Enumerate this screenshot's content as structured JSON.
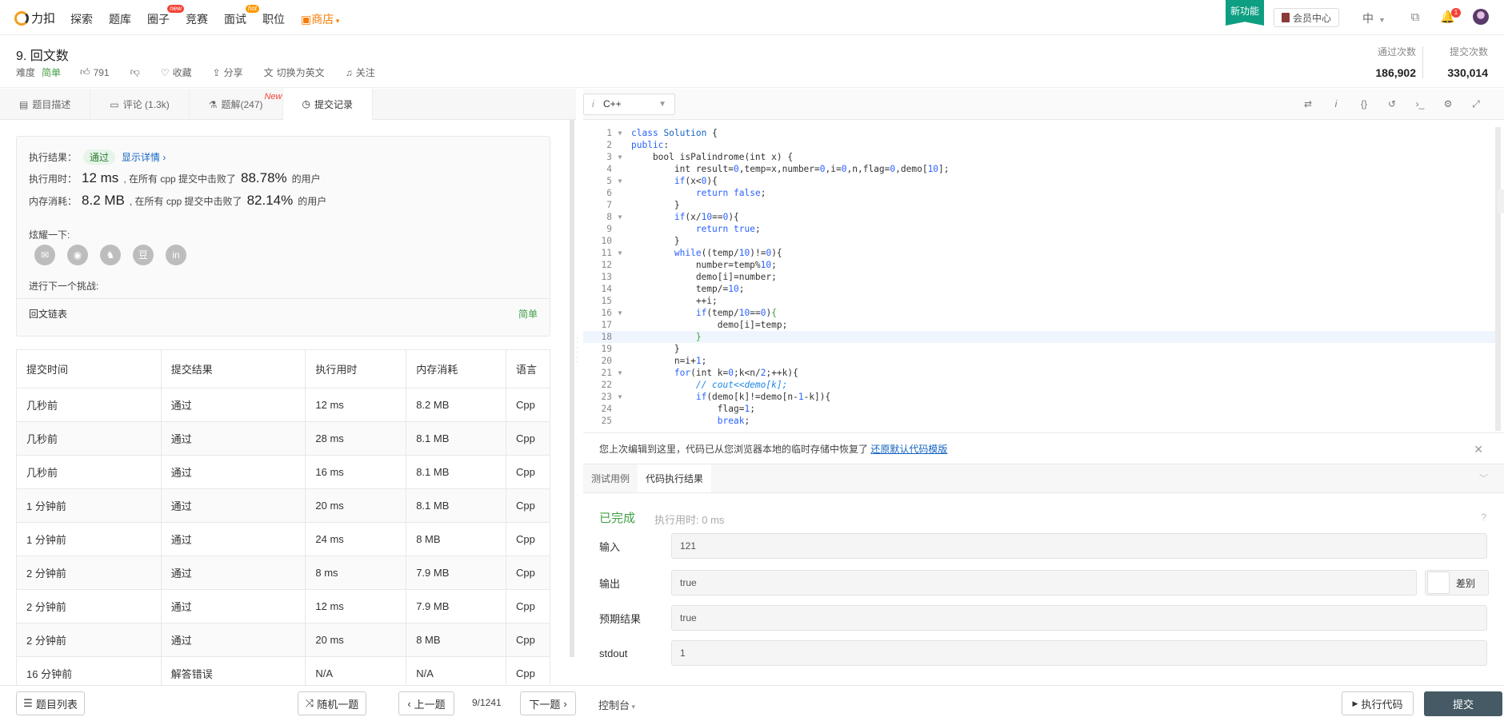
{
  "nav": {
    "logo_text": "力扣",
    "items": [
      "探索",
      "题库",
      "圈子",
      "竞赛",
      "面试",
      "职位"
    ],
    "circle_badge": "new",
    "interview_badge": "hot",
    "shop": "商店",
    "new_feature": "新功能",
    "vip": "会员中心",
    "lang": "中",
    "notif_count": "1"
  },
  "question": {
    "title": "9. 回文数",
    "difficulty_label": "难度",
    "difficulty": "简单",
    "likes": "791",
    "collect": "收藏",
    "share": "分享",
    "switch_lang": "切换为英文",
    "follow": "关注",
    "pass_label": "通过次数",
    "pass_count": "186,902",
    "submit_label": "提交次数",
    "submit_count": "330,014"
  },
  "left_tabs": {
    "desc": "题目描述",
    "comments": "评论 (1.3k)",
    "solutions": "题解(247)",
    "solutions_badge": "New",
    "submissions": "提交记录"
  },
  "result": {
    "label": "执行结果：",
    "status": "通过",
    "details": "显示详情 ›",
    "time_label": "执行用时：",
    "time_value": "12 ms",
    "time_text": ", 在所有 cpp 提交中击败了",
    "time_pct": "88.78%",
    "users": "的用户",
    "mem_label": "内存消耗：",
    "mem_value": "8.2 MB",
    "mem_text": ", 在所有 cpp 提交中击败了",
    "mem_pct": "82.14%",
    "share_label": "炫耀一下:",
    "share_icons": [
      "wechat-icon",
      "weibo-icon",
      "qq-icon",
      "douban-icon",
      "linkedin-icon"
    ],
    "next_label": "进行下一个挑战:",
    "next_problem": "回文链表",
    "next_difficulty": "简单"
  },
  "table": {
    "headers": [
      "提交时间",
      "提交结果",
      "执行用时",
      "内存消耗",
      "语言"
    ],
    "rows": [
      [
        "几秒前",
        "通过",
        "12 ms",
        "8.2 MB",
        "Cpp"
      ],
      [
        "几秒前",
        "通过",
        "28 ms",
        "8.1 MB",
        "Cpp"
      ],
      [
        "几秒前",
        "通过",
        "16 ms",
        "8.1 MB",
        "Cpp"
      ],
      [
        "1 分钟前",
        "通过",
        "20 ms",
        "8.1 MB",
        "Cpp"
      ],
      [
        "1 分钟前",
        "通过",
        "24 ms",
        "8 MB",
        "Cpp"
      ],
      [
        "2 分钟前",
        "通过",
        "8 ms",
        "7.9 MB",
        "Cpp"
      ],
      [
        "2 分钟前",
        "通过",
        "12 ms",
        "7.9 MB",
        "Cpp"
      ],
      [
        "2 分钟前",
        "通过",
        "20 ms",
        "8 MB",
        "Cpp"
      ],
      [
        "16 分钟前",
        "解答错误",
        "N/A",
        "N/A",
        "Cpp"
      ]
    ]
  },
  "editor": {
    "language": "C++",
    "code": [
      "class Solution {",
      "public:",
      "    bool isPalindrome(int x) {",
      "        int result=0,temp=x,number=0,i=0,n,flag=0,demo[10];",
      "        if(x<0){",
      "            return false;",
      "        }",
      "        if(x/10==0){",
      "            return true;",
      "        }",
      "        while((temp/10)!=0){",
      "            number=temp%10;",
      "            demo[i]=number;",
      "            temp/=10;",
      "            ++i;",
      "            if(temp/10==0){",
      "                demo[i]=temp;",
      "            }",
      "        }",
      "        n=i+1;",
      "        for(int k=0;k<n/2;++k){",
      "            // cout<<demo[k];",
      "            if(demo[k]!=demo[n-1-k]){",
      "                flag=1;",
      "                break;"
    ],
    "fold_lines": [
      1,
      3,
      5,
      8,
      11,
      16,
      21,
      23
    ],
    "highlight_line": 18
  },
  "notice": {
    "text": "您上次编辑到这里，代码已从您浏览器本地的临时存储中恢复了",
    "link": "还原默认代码模版"
  },
  "console_tabs": {
    "testcase": "测试用例",
    "result": "代码执行结果"
  },
  "run": {
    "status": "已完成",
    "runtime": "执行用时: 0 ms",
    "input_label": "输入",
    "input": "121",
    "output_label": "输出",
    "output": "true",
    "diff": "差别",
    "expected_label": "预期结果",
    "expected": "true",
    "stdout_label": "stdout",
    "stdout": "1"
  },
  "bottom": {
    "list": "题目列表",
    "random": "随机一题",
    "prev": "上一题",
    "page": "9/1241",
    "next": "下一题",
    "console": "控制台",
    "run": "执行代码",
    "submit": "提交"
  },
  "colors": {
    "accent_green": "#0e9e82",
    "easy": "#43a047",
    "pass": "#26a69a",
    "error": "#e53935",
    "submit_bg": "#455a64"
  }
}
